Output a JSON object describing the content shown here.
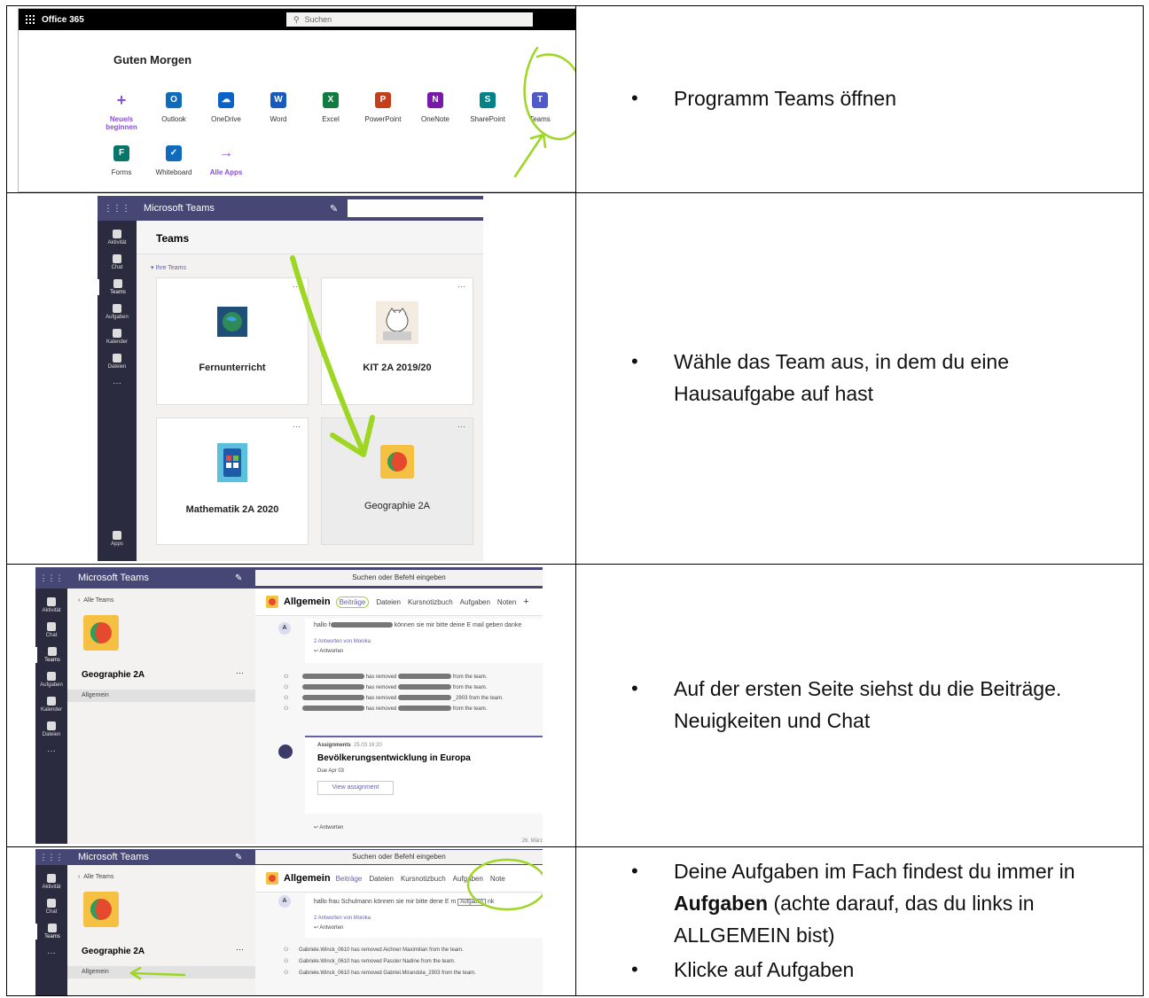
{
  "rows": [
    {
      "bullets": [
        "Programm Teams öffnen"
      ],
      "office": {
        "brand": "Office 365",
        "search_placeholder": "Suchen",
        "greeting": "Guten Morgen",
        "apps_row1": [
          "Neue/s beginnen",
          "Outlook",
          "OneDrive",
          "Word",
          "Excel",
          "PowerPoint",
          "OneNote",
          "SharePoint",
          "Teams"
        ],
        "apps_row2": [
          "Forms",
          "Whiteboard",
          "Alle Apps"
        ]
      }
    },
    {
      "bullets": [
        "Wähle das Team aus, in dem du eine Hausaufgabe auf hast"
      ],
      "teams": {
        "title": "Microsoft Teams",
        "heading": "Teams",
        "section": "Ihre Teams",
        "rail": [
          "Aktivität",
          "Chat",
          "Teams",
          "Aufgaben",
          "Kalender",
          "Dateien",
          "Apps"
        ],
        "cards": [
          "Fernunterricht",
          "KIT 2A 2019/20",
          "Mathematik 2A 2020",
          "Geographie 2A"
        ]
      }
    },
    {
      "bullets": [
        "Auf der ersten Seite siehst du die Beiträge. Neuigkeiten und Chat"
      ],
      "channel": {
        "title": "Microsoft Teams",
        "search": "Suchen oder Befehl eingeben",
        "back": "Alle Teams",
        "team_name": "Geographie 2A",
        "channel_item": "Allgemein",
        "channel_title": "Allgemein",
        "tabs": [
          "Beiträge",
          "Dateien",
          "Kursnotizbuch",
          "Aufgaben",
          "Noten"
        ],
        "msg": "hallo f",
        "msg_tail": "können sie mir bitte deine E mail geben danke",
        "replies": "2 Antworten von Monika",
        "answer": "Antworten",
        "removed": [
          "has removed",
          "from the team."
        ],
        "removed_partial": "_2903 from the team.",
        "assign_label": "Assignments",
        "assign_date": "25.03 16:20",
        "assign_title": "Bevölkerungsentwicklung in Europa",
        "due": "Due Apr 03",
        "view": "View assignment",
        "footer_date": "26. März"
      }
    },
    {
      "bullets_html": [
        [
          "Deine Aufgaben im Fach findest du immer in ",
          "Aufgaben",
          " (achte darauf, das du links in ALLGEMEIN bist)"
        ],
        [
          "Klicke auf Aufgaben"
        ]
      ],
      "channel": {
        "title": "Microsoft Teams",
        "search": "Suchen oder Befehl eingeben",
        "back": "Alle Teams",
        "team_name": "Geographie 2A",
        "channel_item": "Allgemein",
        "channel_title": "Allgemein",
        "tabs": [
          "Beiträge",
          "Dateien",
          "Kursnotizbuch",
          "Aufgaben",
          "Note"
        ],
        "msg": "hallo frau Schulmann können sie mir bitte de",
        "msg_tail": "ne E m",
        "tooltip": "Aufgaben",
        "tooltip_tail": "nk",
        "replies": "2 Antworten von Monika",
        "answer": "Antworten",
        "removed_lines": [
          "Gabriele.Winck_0610 has removed Aichner Maximilian from the team.",
          "Gabriele.Winck_0610 has removed Passler Nadine from the team.",
          "Gabriele.Winck_0610 has removed Gabriel.Mirandola_2903 from the team."
        ]
      }
    }
  ]
}
